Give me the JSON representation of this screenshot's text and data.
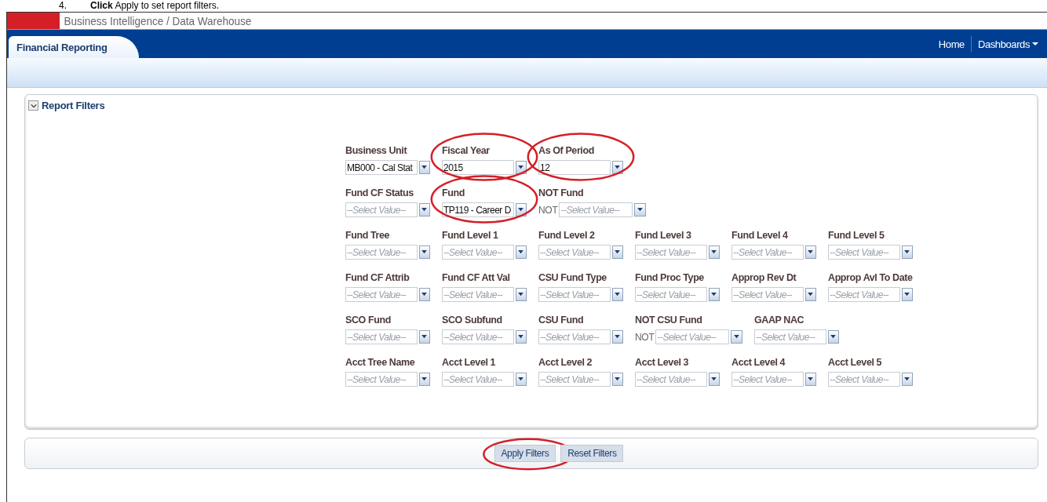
{
  "instruction": {
    "number": "4.",
    "text": "**Click** Apply to set report filters."
  },
  "header": {
    "title": "Business Intelligence / Data Warehouse"
  },
  "tabs": [
    {
      "label": "Financial Reporting",
      "selected": true
    }
  ],
  "nav_links": [
    {
      "label": "Home",
      "kind": "link"
    },
    {
      "label": "Dashboards",
      "kind": "menu"
    }
  ],
  "panel": {
    "title": "Report Filters",
    "expanded": true
  },
  "filter_rows": [
    [
      {
        "label": "Business Unit",
        "value": "MB000 - Cal Stat",
        "highlighted": false
      },
      {
        "label": "Fiscal Year",
        "value": "2015",
        "highlighted": true
      },
      {
        "label": "As Of Period",
        "value": "12",
        "highlighted": true
      }
    ],
    [
      {
        "label": "Fund CF Status",
        "placeholder": "--Select Value--",
        "highlighted": false
      },
      {
        "label": "Fund",
        "value": "TP119 - Career D",
        "highlighted": true
      },
      {
        "label": "NOT Fund",
        "prefix": "NOT",
        "placeholder": "--Select Value--",
        "highlighted": false
      }
    ],
    [
      {
        "label": "Fund Tree",
        "placeholder": "--Select Value--",
        "highlighted": false
      },
      {
        "label": "Fund Level 1",
        "placeholder": "--Select Value--",
        "highlighted": false
      },
      {
        "label": "Fund Level 2",
        "placeholder": "--Select Value--",
        "highlighted": false
      },
      {
        "label": "Fund Level 3",
        "placeholder": "--Select Value--",
        "highlighted": false
      },
      {
        "label": "Fund Level 4",
        "placeholder": "--Select Value--",
        "highlighted": false
      },
      {
        "label": "Fund Level 5",
        "placeholder": "--Select Value--",
        "highlighted": false
      }
    ],
    [
      {
        "label": "Fund CF Attrib",
        "placeholder": "--Select Value--",
        "highlighted": false
      },
      {
        "label": "Fund CF Att Val",
        "placeholder": "--Select Value--",
        "highlighted": false
      },
      {
        "label": "CSU Fund Type",
        "placeholder": "--Select Value--",
        "highlighted": false
      },
      {
        "label": "Fund Proc Type",
        "placeholder": "--Select Value--",
        "highlighted": false
      },
      {
        "label": "Approp Rev Dt",
        "placeholder": "--Select Value--",
        "highlighted": false
      },
      {
        "label": "Approp Avl To Date",
        "placeholder": "--Select Value--",
        "highlighted": false
      }
    ],
    [
      {
        "label": "SCO Fund",
        "placeholder": "--Select Value--",
        "highlighted": false
      },
      {
        "label": "SCO Subfund",
        "placeholder": "--Select Value--",
        "highlighted": false
      },
      {
        "label": "CSU Fund",
        "placeholder": "--Select Value--",
        "highlighted": false
      },
      {
        "label": "NOT CSU Fund",
        "prefix": "NOT",
        "placeholder": "--Select Value--",
        "highlighted": false
      },
      {
        "label": "GAAP NAC",
        "placeholder": "--Select Value--",
        "highlighted": false
      }
    ],
    [
      {
        "label": "Acct Tree Name",
        "placeholder": "--Select Value--",
        "highlighted": false
      },
      {
        "label": "Acct Level 1",
        "placeholder": "--Select Value--",
        "highlighted": false
      },
      {
        "label": "Acct Level 2",
        "placeholder": "--Select Value--",
        "highlighted": false
      },
      {
        "label": "Acct Level 3",
        "placeholder": "--Select Value--",
        "highlighted": false
      },
      {
        "label": "Acct Level 4",
        "placeholder": "--Select Value--",
        "highlighted": false
      },
      {
        "label": "Acct Level 5",
        "placeholder": "--Select Value--",
        "highlighted": false
      }
    ]
  ],
  "buttons": [
    {
      "label": "Apply Filters",
      "highlighted": true
    },
    {
      "label": "Reset Filters",
      "highlighted": false
    }
  ]
}
